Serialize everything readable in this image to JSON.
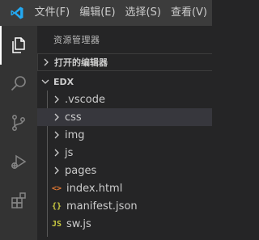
{
  "menu": {
    "items": [
      "文件(F)",
      "编辑(E)",
      "选择(S)",
      "查看(V)"
    ]
  },
  "activity_bar": {
    "items": [
      "files-icon",
      "search-icon",
      "source-control-icon",
      "run-debug-icon",
      "extensions-icon"
    ],
    "active": "files-icon"
  },
  "sidebar": {
    "title": "资源管理器",
    "open_editors": "打开的编辑器",
    "folder": "EDX",
    "tree": [
      {
        "label": ".vscode",
        "type": "folder"
      },
      {
        "label": "css",
        "type": "folder",
        "selected": true
      },
      {
        "label": "img",
        "type": "folder"
      },
      {
        "label": "js",
        "type": "folder"
      },
      {
        "label": "pages",
        "type": "folder"
      },
      {
        "label": "index.html",
        "type": "file",
        "icon": "<>",
        "color": "#e37933"
      },
      {
        "label": "manifest.json",
        "type": "file",
        "icon": "{}",
        "color": "#cbcb41"
      },
      {
        "label": "sw.js",
        "type": "file",
        "icon": "JS",
        "color": "#cbcb41"
      }
    ]
  },
  "colors": {
    "accent": "#23a9f2",
    "titlebar": "#3c3c3c",
    "activitybar": "#333333",
    "sidebar": "#252526",
    "selection": "#37373d"
  }
}
